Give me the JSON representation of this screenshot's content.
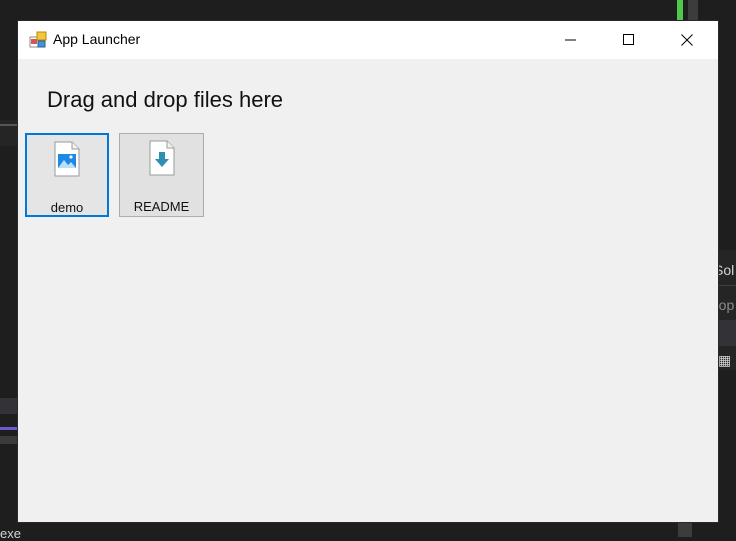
{
  "window": {
    "title": "App Launcher"
  },
  "main": {
    "drop_label": "Drag and drop files here",
    "files": [
      {
        "label": "demo",
        "icon": "image-file-icon",
        "selected": true
      },
      {
        "label": "README",
        "icon": "download-file-icon",
        "selected": false
      }
    ]
  },
  "background": {
    "fragment_sol": "Sol",
    "fragment_prop": "rop",
    "fragment_exe": "exe"
  },
  "colors": {
    "selection_accent": "#0078d7",
    "window_bg": "#f0f0f0",
    "ide_bg": "#1e1e1e"
  }
}
